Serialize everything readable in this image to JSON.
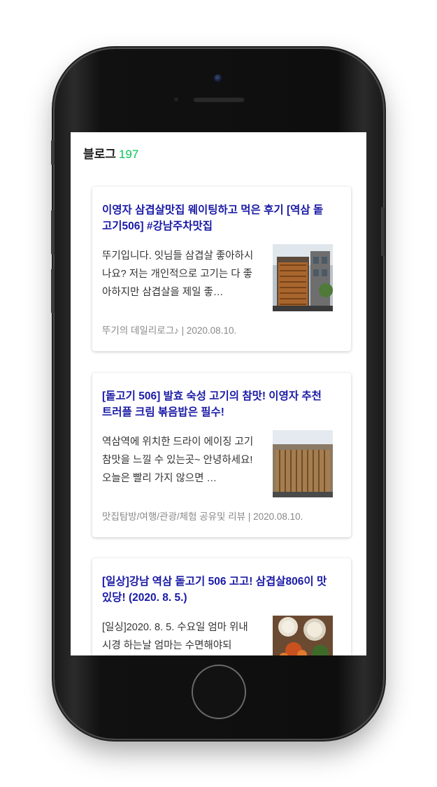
{
  "blog_header": {
    "label": "블로그",
    "count": "197"
  },
  "posts": [
    {
      "title": "이영자 삼겹살맛집 웨이팅하고 먹은 후기 [역삼 돝고기506] #강남주차맛집",
      "description": "뚜기입니다. 잇님들 삼겹살 좋아하시나요? 저는 개인적으로 고기는 다 좋아하지만 삼겹살을 제일 좋…",
      "blog_name": "뚜기의 데일리로그♪",
      "date": "2020.08.10.",
      "thumbnail": "building-facade-thumbnail"
    },
    {
      "title": "[돝고기 506] 발효 숙성 고기의 참맛! 이영자 추천 트러플 크림 볶음밥은 필수!",
      "description": "역삼역에 위치한 드라이 에이징 고기 참맛을 느낄 수 있는곳~ 안녕하세요! 오늘은 빨리 가지 않으면 …",
      "blog_name": "맛집탐방/여행/관광/체험 공유및 리뷰",
      "date": "2020.08.10.",
      "thumbnail": "restaurant-exterior-thumbnail"
    },
    {
      "title": "[일상]강남 역삼 돝고기 506 고고! 삼겹살806이 맛있당! (2020. 8. 5.)",
      "description": "[일싱]2020. 8. 5. 수요일 엄마 위내시경 하는날 엄마는 수면해야되",
      "thumbnail": "food-table-thumbnail"
    }
  ],
  "colors": {
    "title": "#1a1aa6",
    "count": "#03c75a",
    "meta": "#888888"
  }
}
